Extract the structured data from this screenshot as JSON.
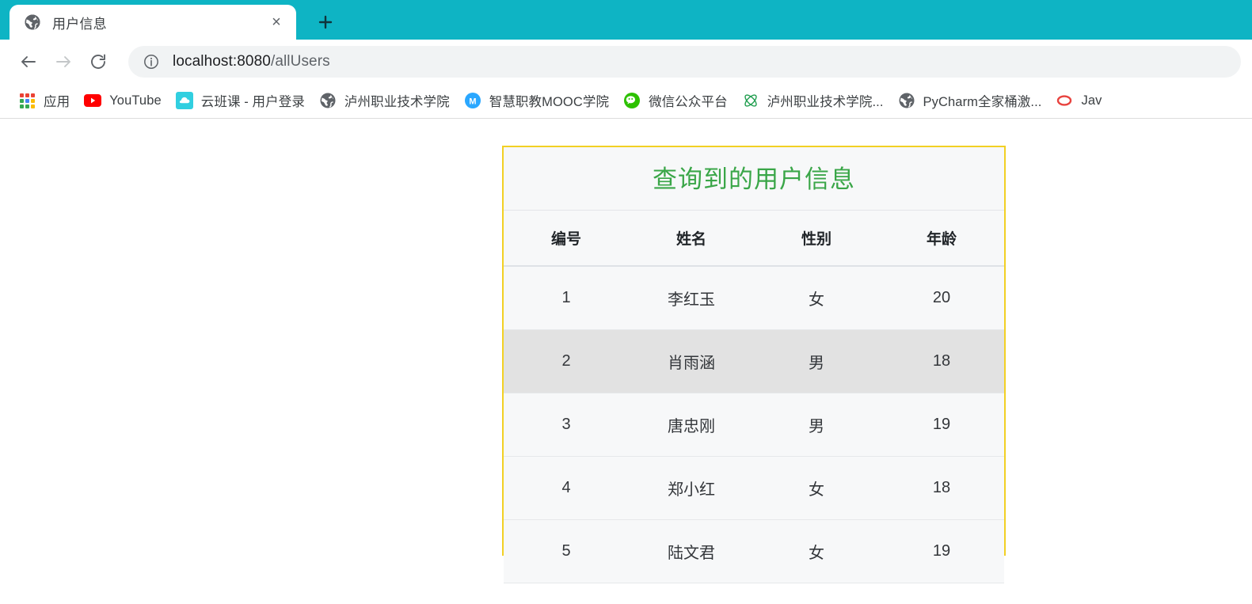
{
  "browser": {
    "tab": {
      "title": "用户信息",
      "favicon": "globe-icon",
      "close_label": "×"
    },
    "new_tab_label": "+",
    "toolbar": {
      "back_label": "back-arrow-icon",
      "forward_label": "forward-arrow-icon",
      "reload_label": "reload-icon",
      "url_host": "localhost:8080",
      "url_path": "/allUsers",
      "url_full": "localhost:8080/allUsers"
    },
    "theme": {
      "tabstrip_color": "#0eb4c4",
      "omnibox_color": "#f1f3f4"
    },
    "bookmarks": [
      {
        "label": "应用",
        "icon": "apps-grid-icon"
      },
      {
        "label": "YouTube",
        "icon": "youtube-icon"
      },
      {
        "label": "云班课 - 用户登录",
        "icon": "cloud-icon"
      },
      {
        "label": "泸州职业技术学院",
        "icon": "globe-icon"
      },
      {
        "label": "智慧职教MOOC学院",
        "icon": "mooc-m-icon"
      },
      {
        "label": "微信公众平台",
        "icon": "wechat-icon"
      },
      {
        "label": "泸州职业技术学院...",
        "icon": "atom-icon"
      },
      {
        "label": "PyCharm全家桶激...",
        "icon": "globe-icon"
      },
      {
        "label": "Jav",
        "icon": "java-oval-icon"
      }
    ]
  },
  "page": {
    "title": "查询到的用户信息",
    "title_color": "#3aa648",
    "border_color": "#f2d024",
    "table": {
      "headers": [
        "编号",
        "姓名",
        "性别",
        "年龄"
      ],
      "rows": [
        {
          "id": "1",
          "name": "李红玉",
          "gender": "女",
          "age": "20",
          "highlighted": false
        },
        {
          "id": "2",
          "name": "肖雨涵",
          "gender": "男",
          "age": "18",
          "highlighted": true
        },
        {
          "id": "3",
          "name": "唐忠刚",
          "gender": "男",
          "age": "19",
          "highlighted": false
        },
        {
          "id": "4",
          "name": "郑小红",
          "gender": "女",
          "age": "18",
          "highlighted": false
        },
        {
          "id": "5",
          "name": "陆文君",
          "gender": "女",
          "age": "19",
          "highlighted": false
        }
      ]
    }
  }
}
